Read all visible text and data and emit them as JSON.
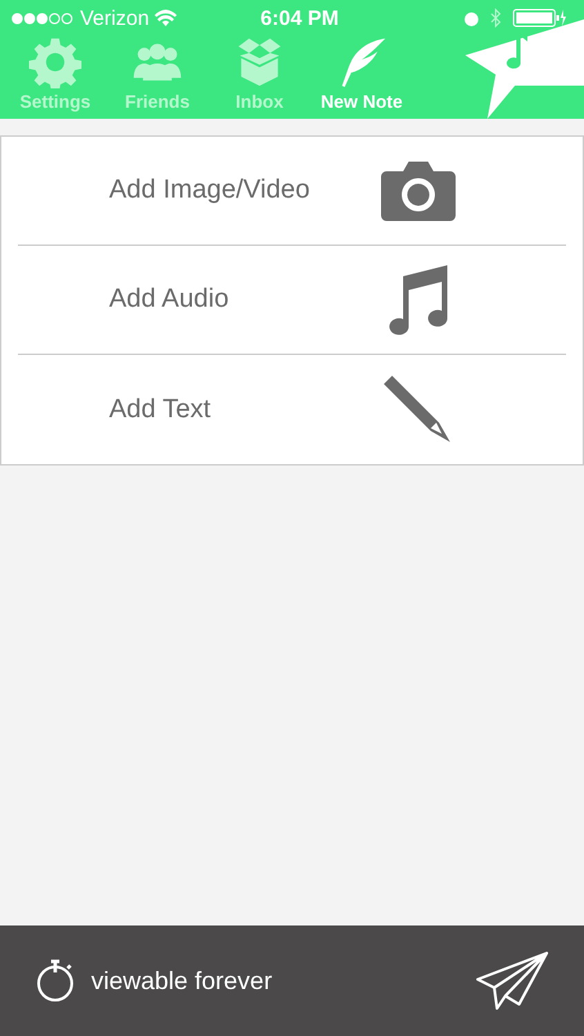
{
  "status_bar": {
    "carrier": "Verizon",
    "time": "6:04 PM"
  },
  "tabs": [
    {
      "label": "Settings",
      "kind": "gear",
      "selected": false
    },
    {
      "label": "Friends",
      "kind": "people",
      "selected": false
    },
    {
      "label": "Inbox",
      "kind": "box",
      "selected": false
    },
    {
      "label": "New Note",
      "kind": "feather",
      "selected": true
    }
  ],
  "options": [
    {
      "label": "Add Image/Video",
      "kind": "camera"
    },
    {
      "label": "Add Audio",
      "kind": "music"
    },
    {
      "label": "Add Text",
      "kind": "pencil"
    }
  ],
  "footer": {
    "label": "viewable forever"
  }
}
